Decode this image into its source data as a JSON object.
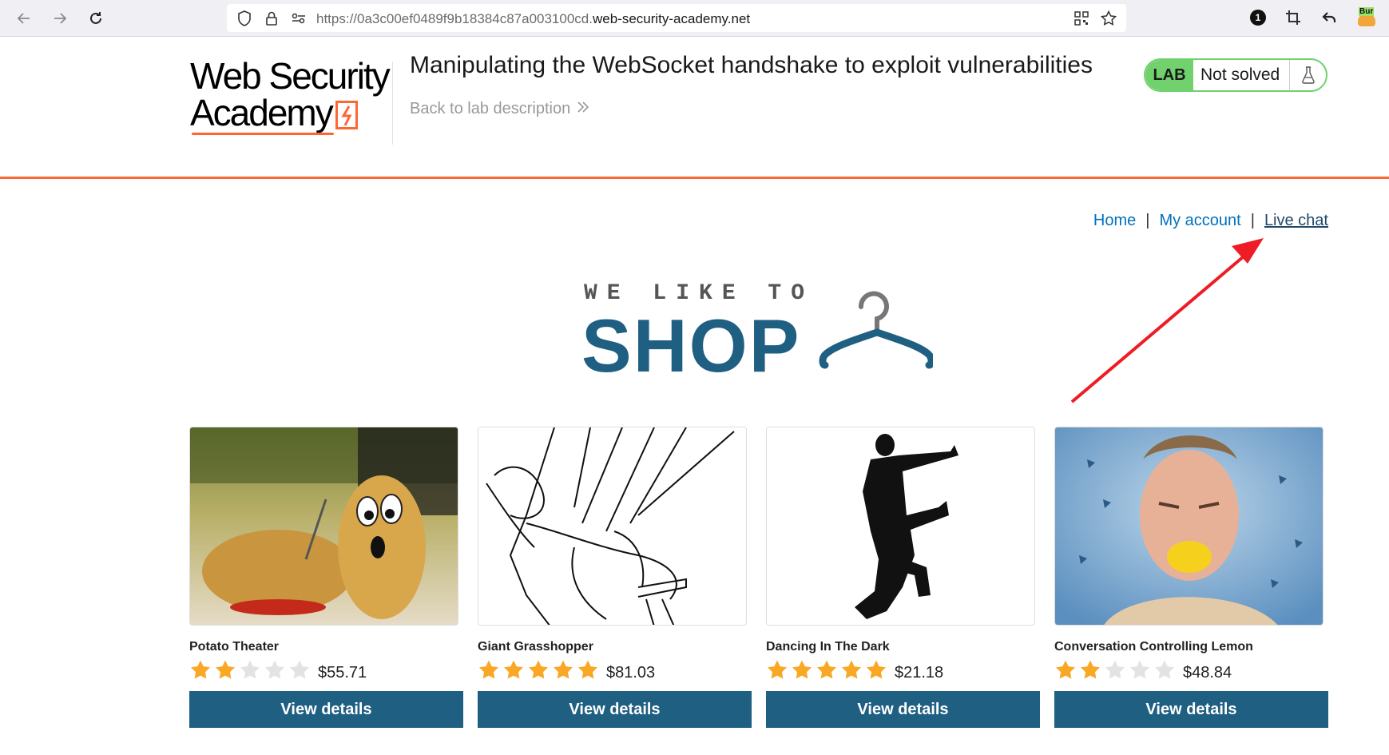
{
  "browser": {
    "url_prefix": "https://0a3c00ef0489f9b18384c87a003100cd.",
    "url_host": "web-security-academy.net",
    "extension_badge": "1",
    "burp_label": "Bur"
  },
  "academy": {
    "logo_line1": "Web Security",
    "logo_line2": "Academy",
    "lab_title": "Manipulating the WebSocket handshake to exploit vulnerabilities",
    "back_link": "Back to lab description",
    "lab_badge": "LAB",
    "status": "Not solved"
  },
  "shop_nav": {
    "home": "Home",
    "separator": "|",
    "my_account": "My account",
    "live_chat": "Live chat"
  },
  "banner": {
    "tagline": "WE LIKE TO",
    "headline": "SHOP"
  },
  "colors": {
    "accent_orange": "#ff6633",
    "lab_green": "#70d16d",
    "shop_blue": "#1f5f82",
    "star_gold": "#f9a825",
    "annotation_red": "#ee1c24"
  },
  "products": [
    {
      "name": "Potato Theater",
      "rating": 2,
      "max_rating": 5,
      "price": "$55.71",
      "button": "View details",
      "image": "potato-image"
    },
    {
      "name": "Giant Grasshopper",
      "rating": 5,
      "max_rating": 5,
      "price": "$81.03",
      "button": "View details",
      "image": "grasshopper-sketch-image"
    },
    {
      "name": "Dancing In The Dark",
      "rating": 5,
      "max_rating": 5,
      "price": "$21.18",
      "button": "View details",
      "image": "dancer-silhouette-image"
    },
    {
      "name": "Conversation Controlling Lemon",
      "rating": 2,
      "max_rating": 5,
      "price": "$48.84",
      "button": "View details",
      "image": "lemon-face-image"
    }
  ]
}
